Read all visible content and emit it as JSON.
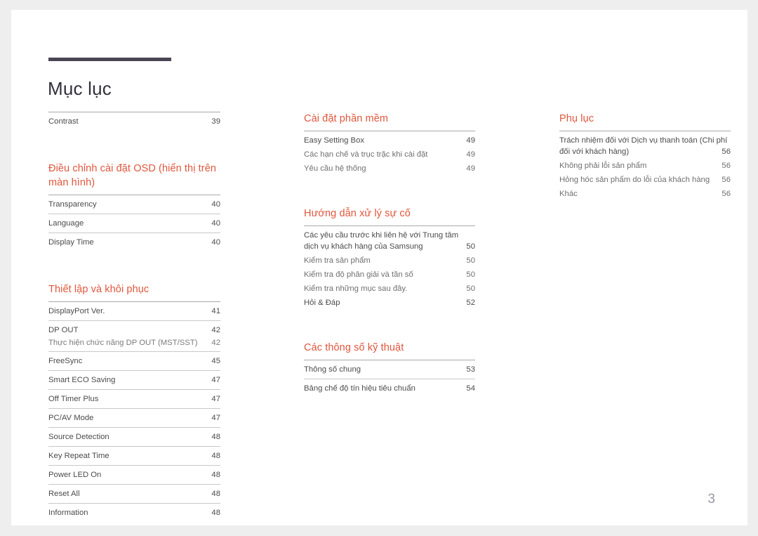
{
  "document": {
    "title": "Mục lục",
    "folio": "3",
    "accent_color": "#e0563c",
    "rule_color": "#4a4552",
    "text_color": "#4b4b4b",
    "folio_color": "#9a9aa4",
    "page_background": "#ffffff",
    "canvas_background": "#eeeeee"
  },
  "columns": [
    {
      "sections": [
        {
          "heading": null,
          "style": "ruled",
          "entries": [
            {
              "label": "Contrast",
              "page": "39",
              "level": 0
            }
          ]
        },
        {
          "heading": "Điều chỉnh cài đặt OSD (hiển thị trên màn hình)",
          "style": "ruled",
          "entries": [
            {
              "label": "Transparency",
              "page": "40",
              "level": 0
            },
            {
              "label": "Language",
              "page": "40",
              "level": 0
            },
            {
              "label": "Display Time",
              "page": "40",
              "level": 0
            }
          ]
        },
        {
          "heading": "Thiết lập và khôi phục",
          "style": "ruled",
          "entries": [
            {
              "label": "DisplayPort Ver.",
              "page": "41",
              "level": 0
            },
            {
              "label": "DP OUT",
              "page": "42",
              "level": 0
            },
            {
              "label": "Thực hiện chức năng DP OUT (MST/SST)",
              "page": "42",
              "level": 1
            },
            {
              "label": "FreeSync",
              "page": "45",
              "level": 0
            },
            {
              "label": "Smart ECO Saving",
              "page": "47",
              "level": 0
            },
            {
              "label": "Off Timer Plus",
              "page": "47",
              "level": 0
            },
            {
              "label": "PC/AV Mode",
              "page": "47",
              "level": 0
            },
            {
              "label": "Source Detection",
              "page": "48",
              "level": 0
            },
            {
              "label": "Key Repeat Time",
              "page": "48",
              "level": 0
            },
            {
              "label": "Power LED On",
              "page": "48",
              "level": 0
            },
            {
              "label": "Reset All",
              "page": "48",
              "level": 0
            },
            {
              "label": "Information",
              "page": "48",
              "level": 0
            }
          ]
        }
      ]
    },
    {
      "sections": [
        {
          "heading": "Cài đặt phần mềm",
          "style": "flat",
          "entries": [
            {
              "label": "Easy Setting Box",
              "page": "49",
              "level": 0
            },
            {
              "label": "Các hạn chế và trục trặc khi cài đặt",
              "page": "49",
              "level": 1
            },
            {
              "label": "Yêu cầu hệ thống",
              "page": "49",
              "level": 1
            }
          ]
        },
        {
          "heading": "Hướng dẫn xử lý sự cố",
          "style": "flat",
          "entries": [
            {
              "label": "Các yêu cầu trước khi liên hệ với Trung tâm dịch vụ khách hàng của Samsung",
              "page": "50",
              "level": 0,
              "wrap": true
            },
            {
              "label": "Kiểm tra sản phẩm",
              "page": "50",
              "level": 1
            },
            {
              "label": "Kiểm tra độ phân giải và tần số",
              "page": "50",
              "level": 1
            },
            {
              "label": "Kiểm tra những mục sau đây.",
              "page": "50",
              "level": 1
            },
            {
              "label": "Hỏi & Đáp",
              "page": "52",
              "level": 0,
              "ruled": true
            }
          ]
        },
        {
          "heading": "Các thông số kỹ thuật",
          "style": "ruled",
          "entries": [
            {
              "label": "Thông số chung",
              "page": "53",
              "level": 0
            },
            {
              "label": "Bảng chế độ tín hiệu tiêu chuẩn",
              "page": "54",
              "level": 0
            }
          ]
        }
      ]
    },
    {
      "sections": [
        {
          "heading": "Phụ lục",
          "style": "flat",
          "entries": [
            {
              "label": "Trách nhiệm đối với Dịch vụ thanh toán (Chi phí đối với khách hàng)",
              "page": "56",
              "level": 0,
              "wrap": true
            },
            {
              "label": "Không phải lỗi sản phẩm",
              "page": "56",
              "level": 1
            },
            {
              "label": "Hỏng hóc sản phẩm do lỗi của khách hàng",
              "page": "56",
              "level": 1
            },
            {
              "label": "Khác",
              "page": "56",
              "level": 1
            }
          ]
        }
      ]
    }
  ]
}
